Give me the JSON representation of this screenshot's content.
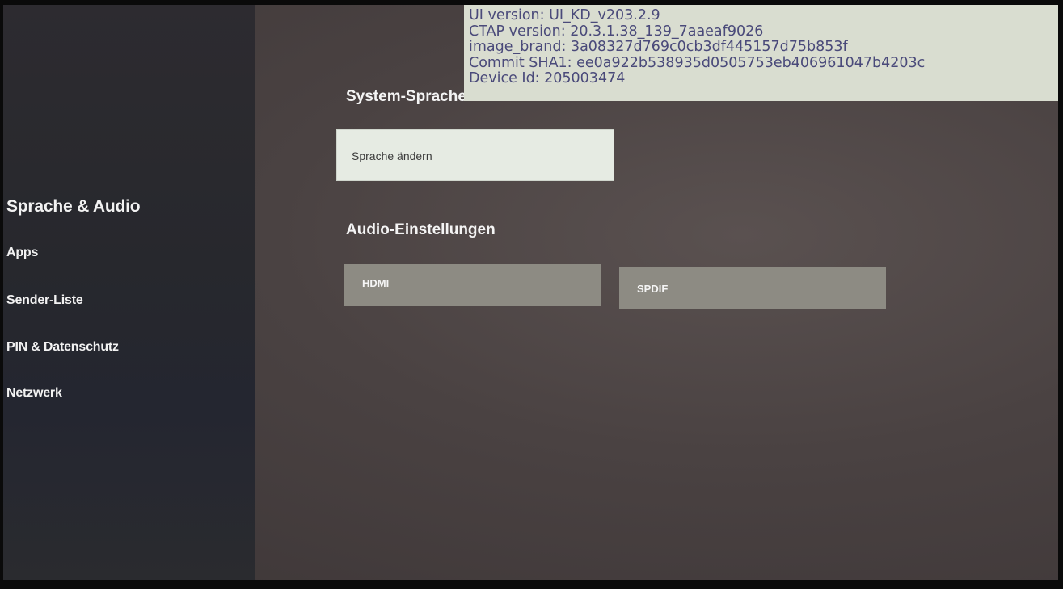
{
  "sidebar": {
    "items": [
      {
        "label": "Sprache & Audio",
        "active": true
      },
      {
        "label": "Apps"
      },
      {
        "label": "Sender-Liste"
      },
      {
        "label": "PIN & Datenschutz"
      },
      {
        "label": "Netzwerk"
      }
    ]
  },
  "main": {
    "system_language": {
      "title": "System-Sprache",
      "button_label": "Sprache ändern"
    },
    "audio": {
      "title": "Audio-Einstellungen",
      "buttons": [
        "HDMI",
        "SPDIF"
      ]
    }
  },
  "debug_overlay": {
    "lines": [
      "UI version: UI_KD_v203.2.9",
      "CTAP version: 20.3.1.38_139_7aaeaf9026",
      "image_brand: 3a08327d769c0cb3df445157d75b853f",
      "Commit SHA1: ee0a922b538935d0505753eb406961047b4203c",
      "Device Id: 205003474"
    ]
  },
  "colors": {
    "sidebar_bg": "#2a2a2f",
    "main_bg": "#4a4242",
    "focused_button": "#e6ebe3",
    "default_button": "#8d8b83",
    "overlay_bg": "#d9ddd0",
    "overlay_text": "#4a4a7a"
  }
}
